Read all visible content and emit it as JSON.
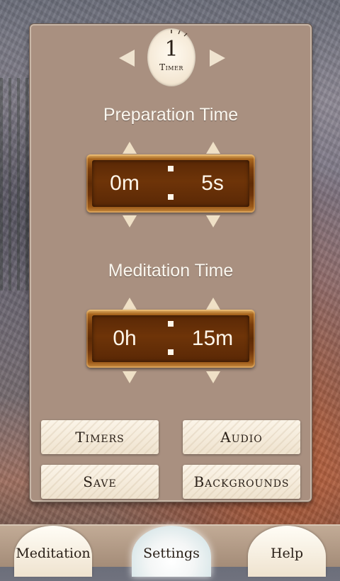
{
  "timer": {
    "number": "1",
    "label": "Timer"
  },
  "preparation": {
    "title": "Preparation Time",
    "left_value": "0m",
    "right_value": "5s"
  },
  "meditation": {
    "title": "Meditation Time",
    "left_value": "0h",
    "right_value": "15m"
  },
  "buttons": {
    "timers": "Timers",
    "audio": "Audio",
    "save": "Save",
    "backgrounds": "Backgrounds"
  },
  "tabs": {
    "meditation": "Meditation",
    "settings": "Settings",
    "help": "Help",
    "active": "settings"
  }
}
